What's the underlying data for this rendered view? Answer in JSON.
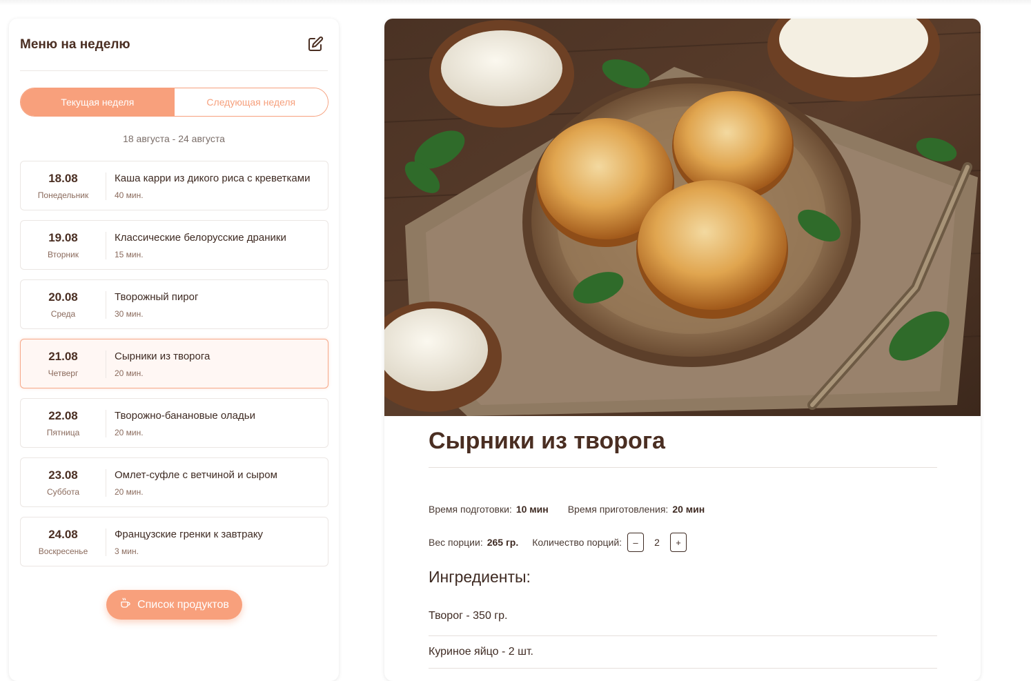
{
  "sidebar": {
    "title": "Меню на неделю",
    "edit_icon": "edit-icon",
    "tabs": {
      "current": "Текущая неделя",
      "next": "Следующая неделя"
    },
    "date_range": "18 августа - 24 августа",
    "days": [
      {
        "date": "18.08",
        "weekday": "Понедельник",
        "title": "Каша карри из дикого риса с креветками",
        "time": "40 мин."
      },
      {
        "date": "19.08",
        "weekday": "Вторник",
        "title": "Классические белорусские драники",
        "time": "15 мин."
      },
      {
        "date": "20.08",
        "weekday": "Среда",
        "title": "Творожный пирог",
        "time": "30 мин."
      },
      {
        "date": "21.08",
        "weekday": "Четверг",
        "title": "Сырники из творога",
        "time": "20 мин."
      },
      {
        "date": "22.08",
        "weekday": "Пятница",
        "title": "Творожно-банановые оладьи",
        "time": "20 мин."
      },
      {
        "date": "23.08",
        "weekday": "Суббота",
        "title": "Омлет-суфле с ветчиной и сыром",
        "time": "20 мин."
      },
      {
        "date": "24.08",
        "weekday": "Воскресенье",
        "title": "Французские гренки к завтраку",
        "time": "3 мин."
      }
    ],
    "shopping_button": "Список продуктов",
    "shopping_icon": "cup-icon"
  },
  "recipe": {
    "title": "Сырники из творога",
    "prep_label": "Время подготовки:",
    "prep_value": "10 мин",
    "cook_label": "Время приготовления:",
    "cook_value": "20 мин",
    "weight_label": "Вес порции:",
    "weight_value": "265 гр.",
    "servings_label": "Количество порций:",
    "servings_minus": "–",
    "servings_value": "2",
    "servings_plus": "+",
    "ingredients_title": "Ингредиенты:",
    "ingredients": [
      "Творог - 350 гр.",
      "Куриное яйцо - 2 шт."
    ]
  },
  "colors": {
    "accent": "#f8a07c",
    "text_brown": "#4a2e22",
    "active_bg": "#fff7f4"
  }
}
